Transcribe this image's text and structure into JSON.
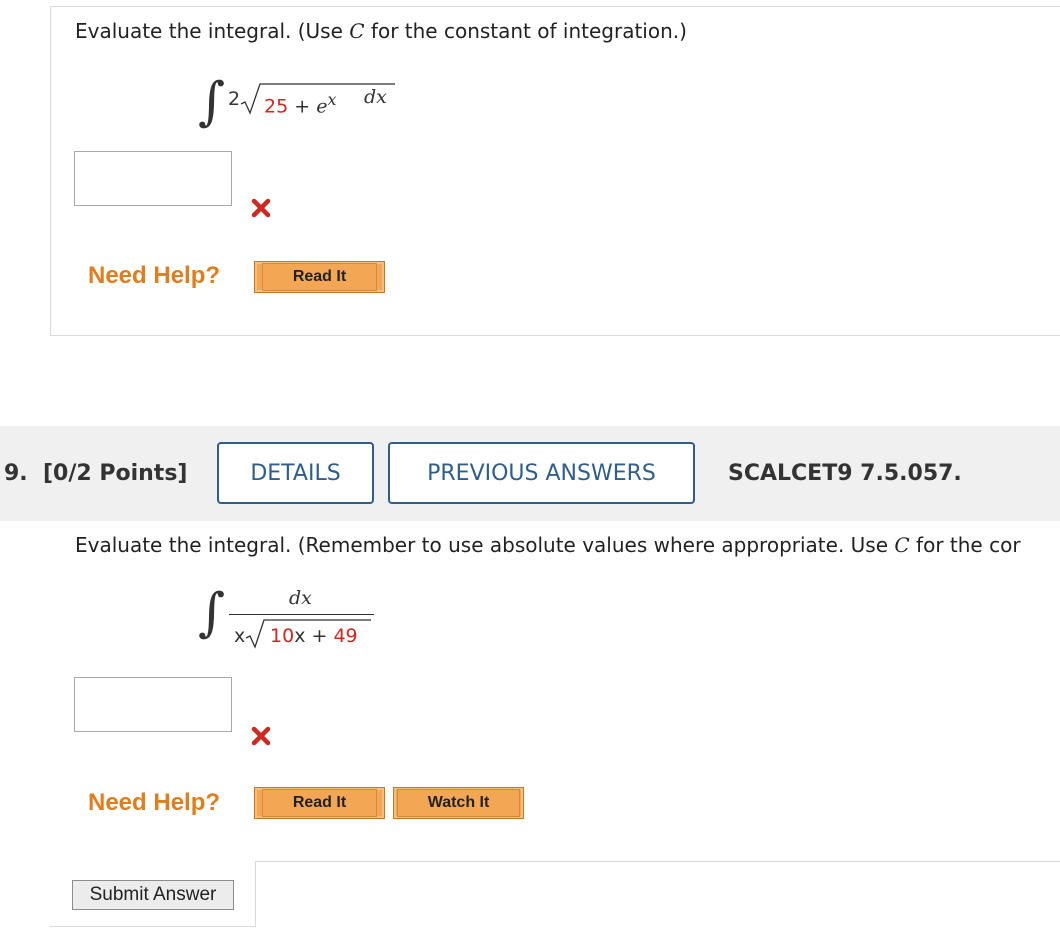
{
  "q8": {
    "prompt_text": "Evaluate the integral. (Use ",
    "prompt_var": "C",
    "prompt_end": " for the constant of integration.)",
    "integral_sign": "∫",
    "coef": "2",
    "radicand_num": "25",
    "plus": " + ",
    "exp_base": "e",
    "exp_power": "x",
    "dx": "dx",
    "answer_value": "",
    "status_icon": "x-mark-icon",
    "need_help": "Need Help?",
    "read_it": "Read It"
  },
  "q9": {
    "number": "9.",
    "points": "[0/2 Points]",
    "details_label": "DETAILS",
    "previous_answers_label": "PREVIOUS ANSWERS",
    "ref_code": "SCALCET9 7.5.057.",
    "prompt_text": "Evaluate the integral. (Remember to use absolute values where appropriate. Use ",
    "prompt_var": "C",
    "prompt_end": " for the cor",
    "integral_sign": "∫",
    "numerator": "dx",
    "denom_x": "x",
    "radicand_coef": "10",
    "radicand_var": "x",
    "plus": " + ",
    "radicand_const": "49",
    "answer_value": "",
    "status_icon": "x-mark-icon",
    "need_help": "Need Help?",
    "read_it": "Read It",
    "watch_it": "Watch It",
    "submit_label": "Submit Answer"
  },
  "colors": {
    "accent_blue": "#2f5e8e",
    "help_orange": "#e27d1e",
    "button_orange": "#f3a654",
    "error_red": "#d0281f"
  }
}
